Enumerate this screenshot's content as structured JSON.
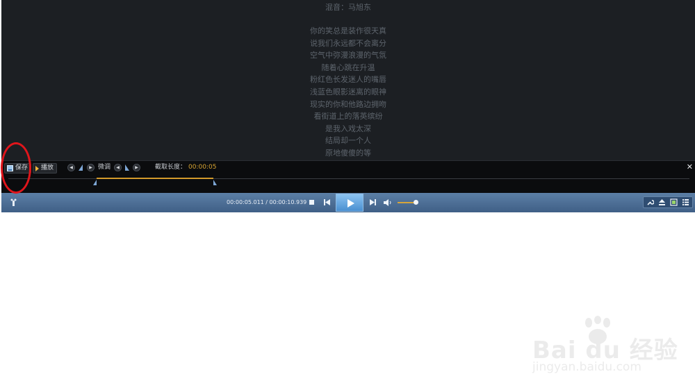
{
  "lyrics": {
    "credit": "混音：马旭东",
    "lines": [
      "你的笑总是装作很天真",
      "说我们永远都不会离分",
      "空气中弥漫浪漫的气氛",
      "随着心跳在升温",
      "粉红色长发迷人的嘴唇",
      "浅蓝色眼影迷离的眼神",
      "现实的你和他路边拥吻",
      "看街道上的落英缤纷",
      "是我入戏太深",
      "结局却一个人",
      "原地傻傻的等"
    ]
  },
  "clipbar": {
    "save_label": "保存",
    "play_label": "播放",
    "finetune_label": "微调",
    "length_label": "截取长度：",
    "length_value": "00:00:05",
    "close_glyph": "✕",
    "left_glyph": "◀",
    "right_glyph": "▶"
  },
  "controls": {
    "time": "00:00:05.011 / 00:00:10.939",
    "volume_level": 0.85
  },
  "watermark": {
    "logo": "Bai du 经验",
    "url": "jingyan.baidu.com"
  },
  "colors": {
    "accent": "#d9a532",
    "annotation": "#e0151b",
    "control_bar": "#4f7198"
  }
}
